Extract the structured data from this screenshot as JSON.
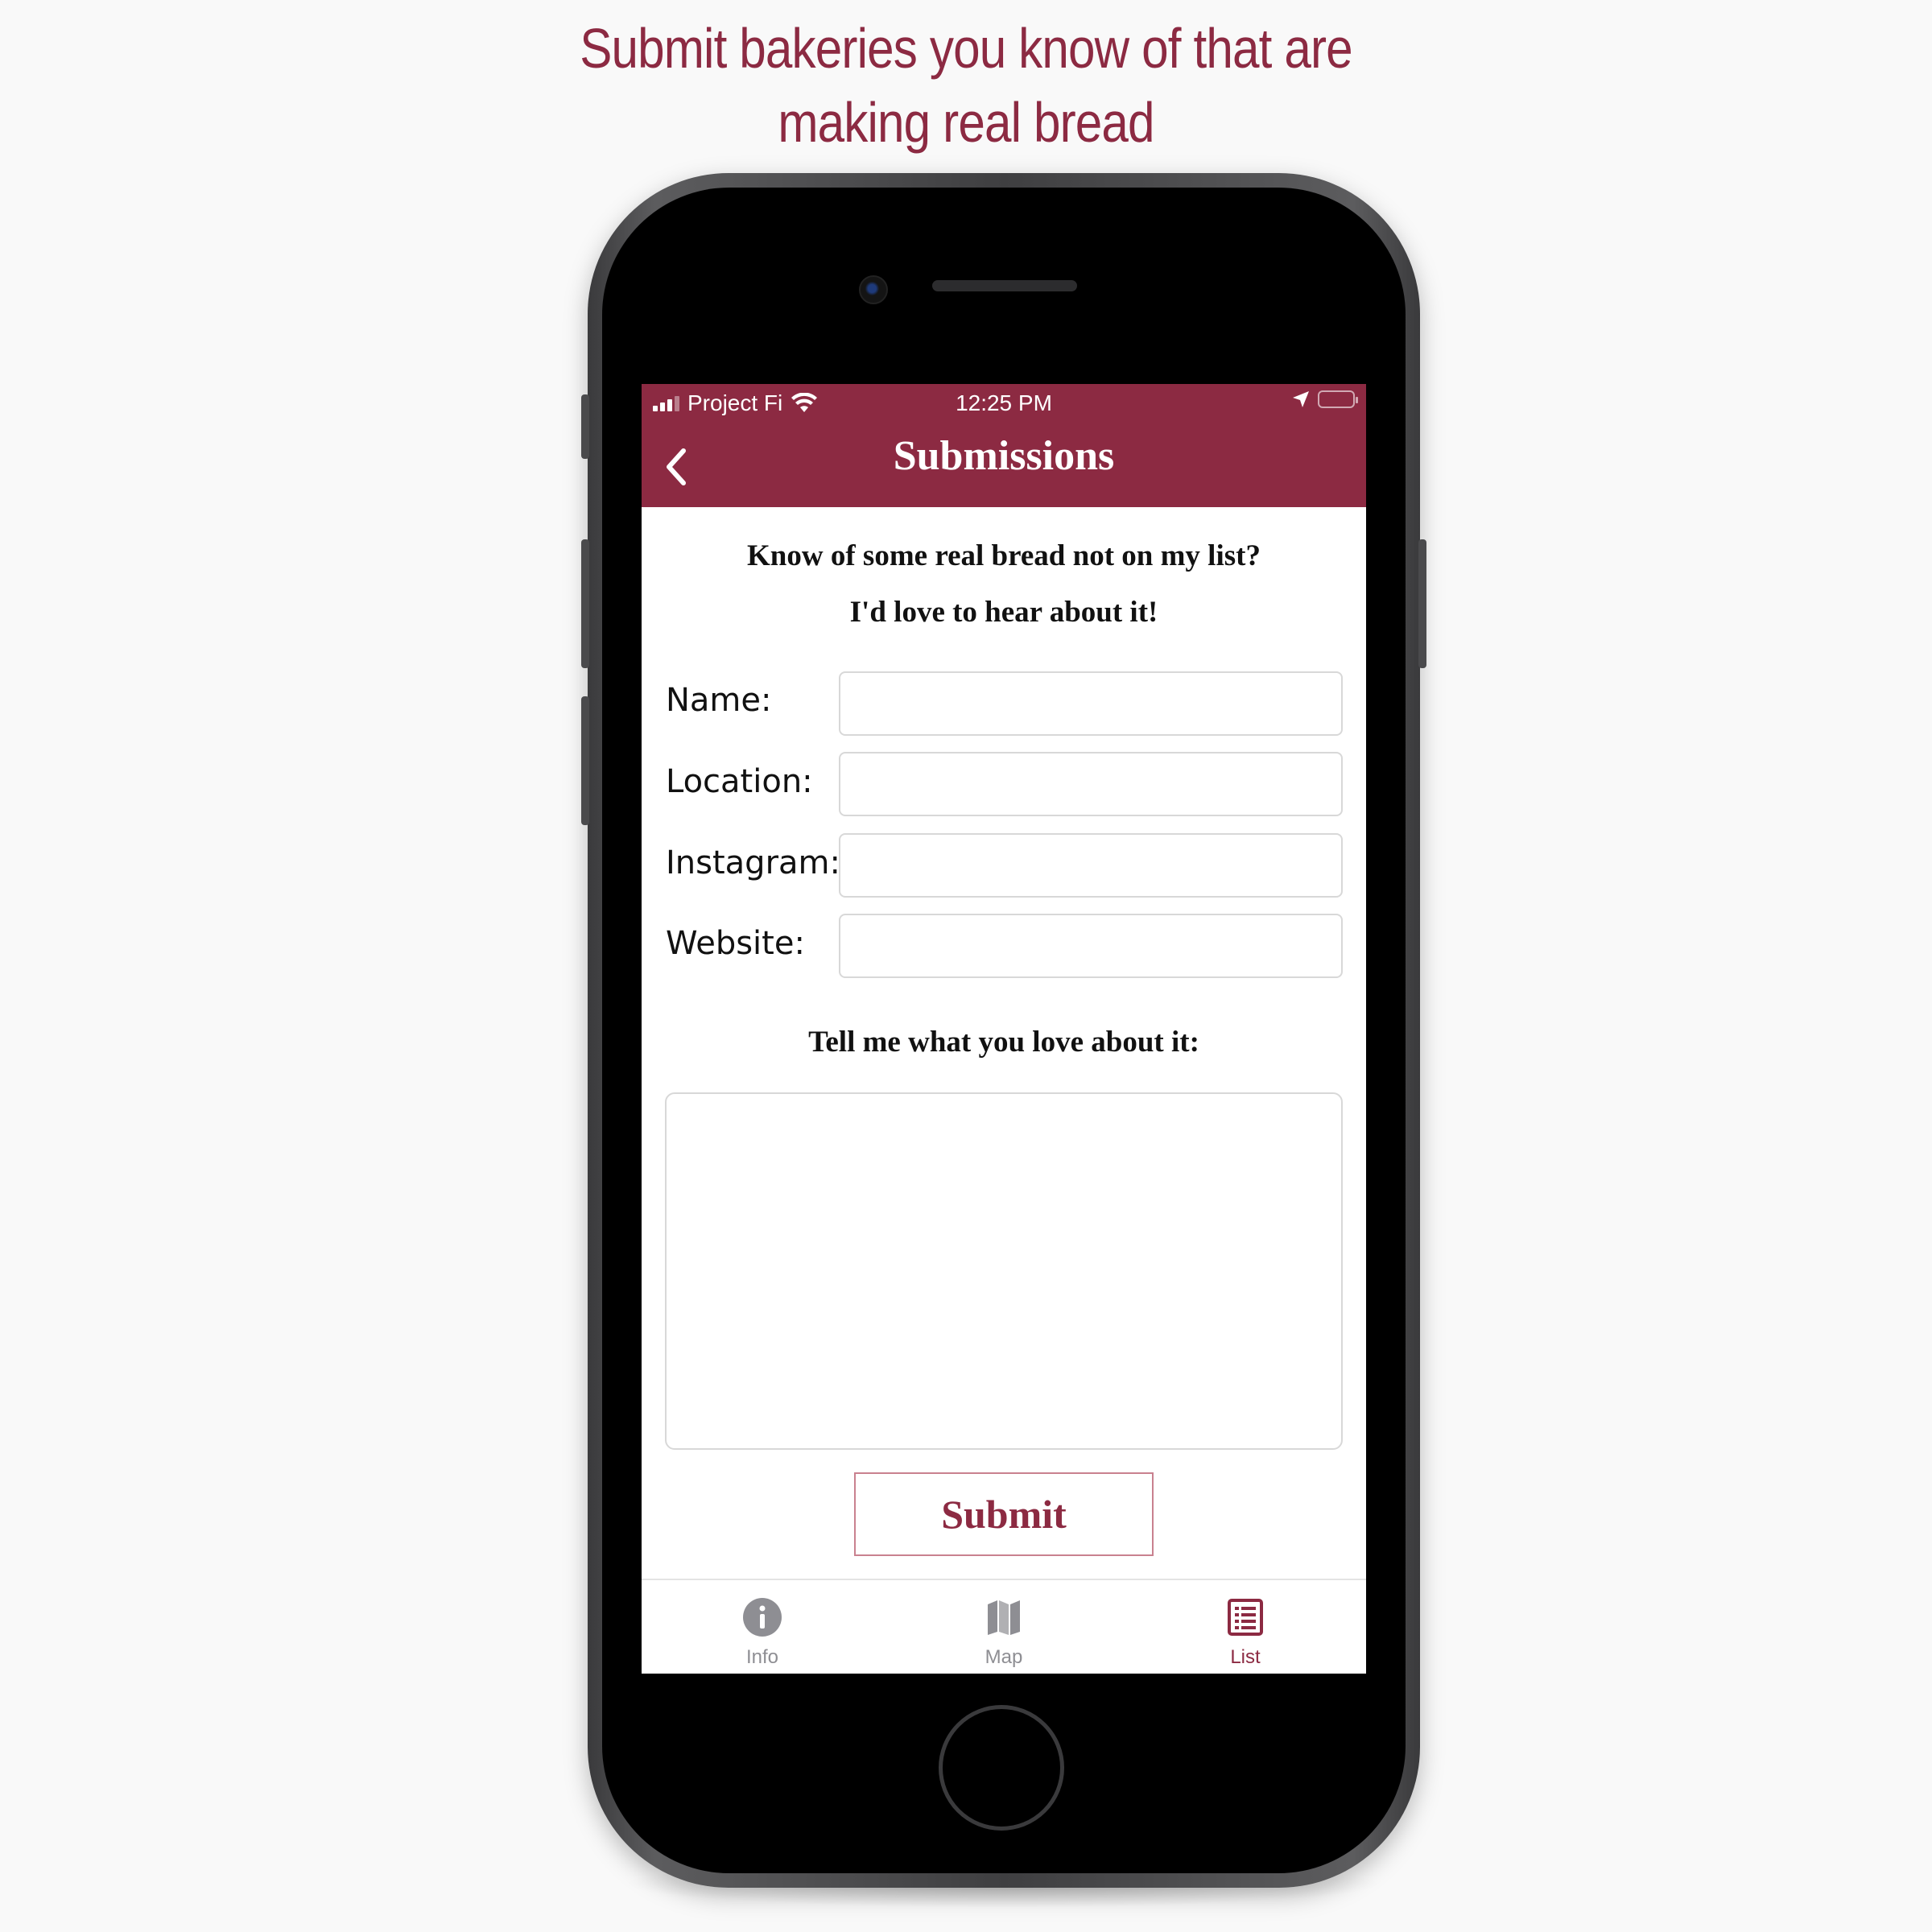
{
  "headline": {
    "line1": "Submit bakeries you know of that are",
    "line2": "making real bread"
  },
  "status_bar": {
    "carrier": "Project Fi",
    "time": "12:25 PM",
    "icons": [
      "signal-icon",
      "wifi-icon",
      "location-arrow-icon",
      "battery-charging-icon"
    ]
  },
  "nav": {
    "title": "Submissions",
    "back_icon": "chevron-left-icon"
  },
  "intro": {
    "line1": "Know of some real bread not on my list?",
    "line2": "I'd love to hear about it!"
  },
  "form": {
    "fields": [
      {
        "label": "Name:",
        "value": ""
      },
      {
        "label": "Location:",
        "value": ""
      },
      {
        "label": "Instagram:",
        "value": ""
      },
      {
        "label": "Website:",
        "value": ""
      }
    ],
    "comments_label": "Tell me what you love about it:",
    "comments_value": "",
    "submit_label": "Submit"
  },
  "tabs": [
    {
      "label": "Info",
      "icon": "info-icon",
      "active": false
    },
    {
      "label": "Map",
      "icon": "map-icon",
      "active": false
    },
    {
      "label": "List",
      "icon": "list-icon",
      "active": true
    }
  ],
  "colors": {
    "brand": "#8c2a42",
    "inactive": "#8e8e93",
    "battery": "#3fd05a"
  }
}
